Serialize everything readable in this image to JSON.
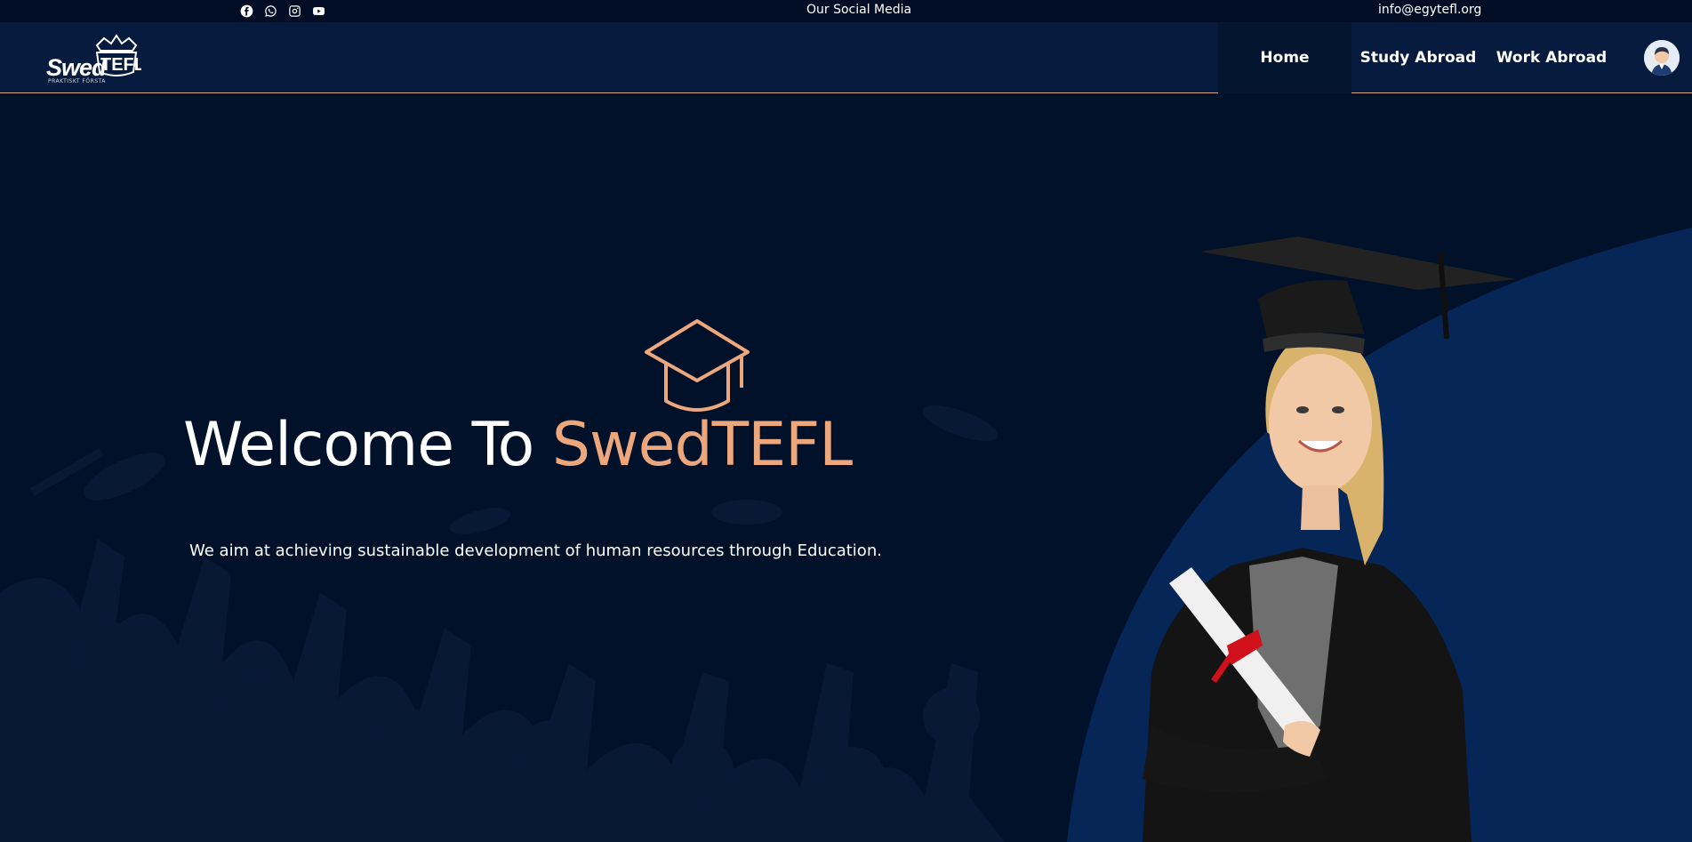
{
  "topbar": {
    "social_icons": [
      "facebook-icon",
      "whatsapp-icon",
      "instagram-icon",
      "youtube-icon"
    ],
    "center_text": "Our Social Media",
    "email": "info@egytefl.org"
  },
  "header": {
    "logo": {
      "word": "SwedTEFL",
      "tagline": "PRAKTISKT FÖRSTA"
    },
    "nav": [
      {
        "label": "Home",
        "active": true
      },
      {
        "label": "Study Abroad",
        "active": false
      },
      {
        "label": "Work Abroad",
        "active": false
      }
    ]
  },
  "hero": {
    "title_prefix": "Welcome To ",
    "title_accent": "SwedTEFL",
    "subtitle": "We aim at achieving sustainable development of human resources through Education."
  },
  "colors": {
    "background": "#01112a",
    "header": "#061b3e",
    "topbar": "#000d24",
    "accent": "#eca77c",
    "arc": "#08265a"
  }
}
